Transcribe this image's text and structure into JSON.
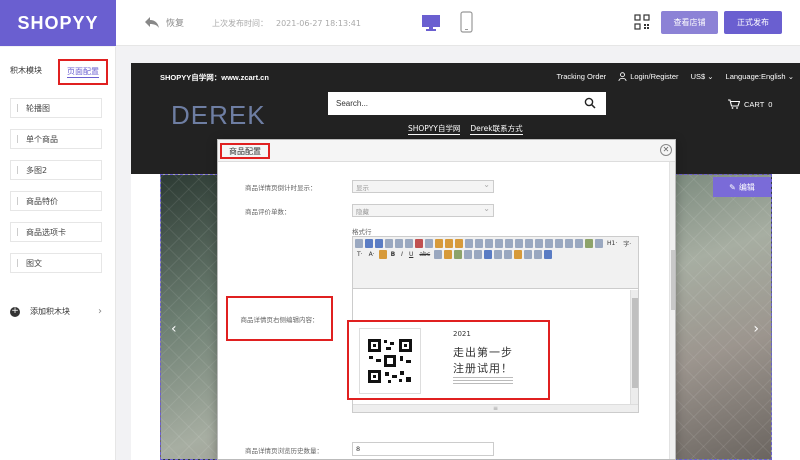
{
  "topbar": {
    "logo": "SHOPYY",
    "undo_label": "恢复",
    "last_publish_label": "上次发布时间：",
    "last_publish_time": "2021-06-27 18:13:41",
    "view_store_label": "查看店铺",
    "publish_label": "正式发布"
  },
  "sidebar": {
    "tab_blocks": "积木模块",
    "tab_page_config": "页面配置",
    "items": [
      {
        "label": "轮播图"
      },
      {
        "label": "单个商品"
      },
      {
        "label": "多图2"
      },
      {
        "label": "商品特价"
      },
      {
        "label": "商品选项卡"
      },
      {
        "label": "图文"
      }
    ],
    "add_block_label": "添加积木块"
  },
  "store": {
    "site_name": "SHOPYY自学网：www.zcart.cn",
    "track_order": "Tracking Order",
    "login_register": "Login/Register",
    "currency": "US$",
    "language": "Language:English",
    "logo_text": "DEREK",
    "search_placeholder": "Search...",
    "cart_label": "CART",
    "cart_count": "0",
    "nav_links": [
      "SHOPYY自学网",
      "Derek联系方式"
    ],
    "edit_label": "编辑",
    "arrow_left": "‹",
    "arrow_right": "›"
  },
  "modal": {
    "title": "商品配置",
    "fields": {
      "f1_label": "商品详情页倒计时显示：",
      "f1_value": "显示",
      "f2_label": "商品评价单数：",
      "f2_value": "隐藏",
      "editor_label": "商品详情页右侧编辑内容：",
      "editor_hint": "格式行",
      "f4_label": "商品详情页浏览历史数量：",
      "f4_value": "8"
    },
    "toolbar_text": [
      "H1·",
      "字·",
      "T·",
      "A·",
      "B",
      "I",
      "U",
      "abc",
      "X₂",
      "X²"
    ],
    "poster": {
      "year": "2021",
      "line1": "走出第一步",
      "line2": "注册试用！"
    }
  },
  "colors": {
    "brand": "#6a5fd0",
    "highlight": "#e02020"
  }
}
